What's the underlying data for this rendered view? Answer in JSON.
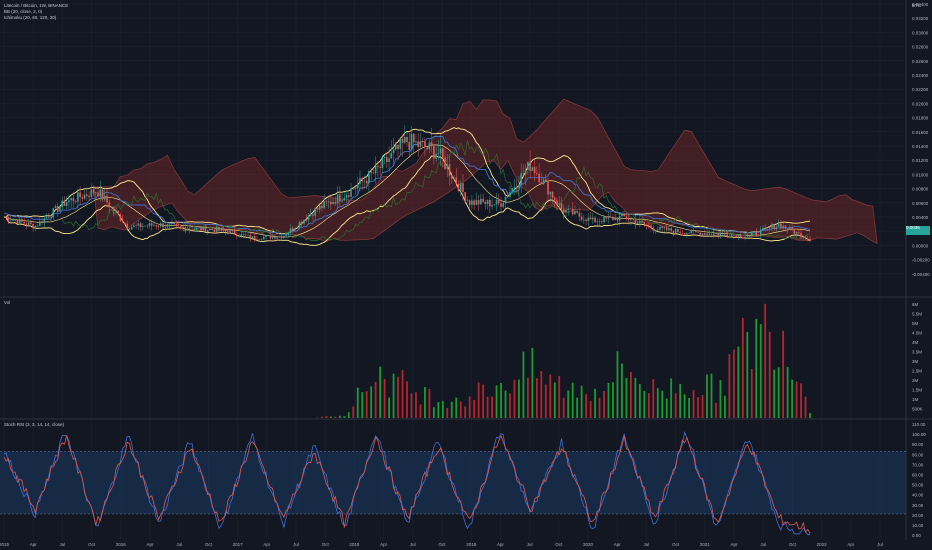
{
  "main": {
    "symbol": "Litecoin / Bitcoin, 1W, BINANCE",
    "indicators": [
      "BB (20, close, 2, 0)",
      "Ichimoku (20, 60, 120, 30)"
    ],
    "currency": "BTC",
    "current_price": "0.0036",
    "price_axis": [
      "0.03400",
      "0.03200",
      "0.03000",
      "0.02800",
      "0.02600",
      "0.02400",
      "0.02200",
      "0.02000",
      "0.01800",
      "0.01600",
      "0.01400",
      "0.01200",
      "0.01000",
      "0.00800",
      "0.00600",
      "0.00400",
      "0.00200",
      "0.00000",
      "-0.00200",
      "-0.00400"
    ]
  },
  "volume": {
    "label": "Vol",
    "axis": [
      "6M",
      "5.5M",
      "5M",
      "4.5M",
      "4M",
      "3.5M",
      "3M",
      "2.5M",
      "2M",
      "1.5M",
      "1M",
      "500K"
    ]
  },
  "rsi": {
    "label": "Stoch RSI (3, 3, 14, 14, close)",
    "axis": [
      "110.00",
      "100.00",
      "90.00",
      "80.00",
      "70.00",
      "60.00",
      "50.00",
      "40.00",
      "30.00",
      "20.00",
      "10.00",
      "0.00"
    ]
  },
  "time_axis": [
    "2015",
    "Apr",
    "Jul",
    "Oct",
    "2016",
    "Apr",
    "Jul",
    "Oct",
    "2017",
    "Apr",
    "Jul",
    "Oct",
    "2018",
    "Apr",
    "Jul",
    "Oct",
    "2019",
    "Apr",
    "Jul",
    "Oct",
    "2020",
    "Apr",
    "Jul",
    "Oct",
    "2021",
    "Apr",
    "Jul",
    "Oct",
    "2022",
    "Apr",
    "Jul"
  ],
  "colors": {
    "bg": "#131722",
    "up": "#26a69a",
    "down": "#ef5350",
    "vol_up": "#1b9c32",
    "vol_down": "#b3262e",
    "bb": "#ffe98a",
    "tenkan": "#3e72c9",
    "cloud": "#7d2a2a",
    "span_b": "#8a3a3a",
    "chikou": "#2f6b2f",
    "rsi_k": "#3f6ed8",
    "rsi_d": "#e0584d",
    "band": "#1a3a63"
  },
  "chart_data": [
    {
      "type": "line",
      "title": "Litecoin / Bitcoin, 1W, BINANCE",
      "x": [
        "2015",
        "Apr",
        "Jul",
        "Oct",
        "2016",
        "Apr",
        "Jul",
        "Oct",
        "2017",
        "Apr",
        "Jul",
        "Oct",
        "2018",
        "Apr",
        "Jul",
        "Oct",
        "2019",
        "Apr",
        "Jul",
        "Oct",
        "2020",
        "Apr",
        "Jul",
        "Oct",
        "2021",
        "Apr",
        "Jul"
      ],
      "series": [
        {
          "name": "close",
          "values": [
            0.0065,
            0.0053,
            0.0085,
            0.01,
            0.0052,
            0.0055,
            0.005,
            0.0048,
            0.0038,
            0.004,
            0.0073,
            0.0095,
            0.0125,
            0.0165,
            0.015,
            0.0085,
            0.0082,
            0.0135,
            0.0075,
            0.006,
            0.0065,
            0.005,
            0.0045,
            0.0043,
            0.004,
            0.0055,
            0.0036
          ]
        }
      ],
      "ylim": [
        -0.004,
        0.035
      ]
    },
    {
      "type": "bar",
      "title": "Vol",
      "x": [
        "2015",
        "Apr",
        "Jul",
        "Oct",
        "2016",
        "Apr",
        "Jul",
        "Oct",
        "2017",
        "Apr",
        "Jul",
        "Oct",
        "2018",
        "Apr",
        "Jul",
        "Oct",
        "2019",
        "Apr",
        "Jul",
        "Oct",
        "2020",
        "Apr",
        "Jul",
        "Oct",
        "2021",
        "Apr",
        "Jul"
      ],
      "values": [
        0,
        0,
        0,
        0,
        0,
        0,
        0,
        0,
        0,
        0,
        0,
        200000,
        2400000,
        1600000,
        1000000,
        1100000,
        1800000,
        2500000,
        1600000,
        1400000,
        2700000,
        1400000,
        1800000,
        1500000,
        4100000,
        5000000,
        500000
      ],
      "ylim": [
        0,
        6000000
      ]
    },
    {
      "type": "line",
      "title": "Stoch RSI (3, 3, 14, 14, close)",
      "x": [
        "2015",
        "Apr",
        "Jul",
        "Oct",
        "2016",
        "Apr",
        "Jul",
        "Oct",
        "2017",
        "Apr",
        "Jul",
        "Oct",
        "2018",
        "Apr",
        "Jul",
        "Oct",
        "2019",
        "Apr",
        "Jul",
        "Oct",
        "2020",
        "Apr",
        "Jul",
        "Oct",
        "2021",
        "Apr",
        "Jul"
      ],
      "series": [
        {
          "name": "K",
          "values": [
            80,
            20,
            100,
            5,
            95,
            10,
            90,
            5,
            95,
            10,
            85,
            5,
            100,
            10,
            90,
            5,
            100,
            20,
            90,
            5,
            95,
            10,
            100,
            5,
            95,
            10,
            0
          ]
        },
        {
          "name": "D",
          "values": [
            78,
            25,
            95,
            10,
            90,
            15,
            85,
            10,
            90,
            15,
            80,
            10,
            95,
            15,
            85,
            10,
            95,
            25,
            85,
            10,
            90,
            15,
            95,
            10,
            90,
            15,
            5
          ]
        }
      ],
      "ylim": [
        -5,
        110
      ],
      "bands": [
        20,
        80
      ]
    }
  ]
}
